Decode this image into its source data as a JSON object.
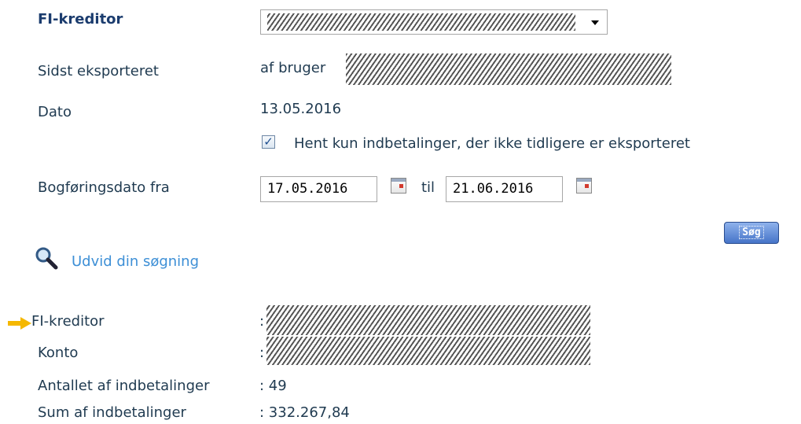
{
  "form": {
    "fi_kreditor_label": "FI-kreditor",
    "sidst_eksporteret_label": "Sidst eksporteret",
    "af_bruger_text": "af bruger",
    "dato_label": "Dato",
    "dato_value": "13.05.2016",
    "checkbox_label": "Hent kun indbetalinger, der ikke tidligere er eksporteret",
    "checkbox_checked": true,
    "bogforingsdato_label": "Bogføringsdato fra",
    "date_from": "17.05.2016",
    "til_label": "til",
    "date_to": "21.06.2016",
    "search_button": "Søg"
  },
  "expand_search_link": "Udvid din søgning",
  "results": {
    "fi_kreditor_label": "FI-kreditor",
    "konto_label": "Konto",
    "antallet_label": "Antallet af indbetalinger",
    "antallet_value": ": 49",
    "sum_label": "Sum af indbetalinger",
    "sum_value": ": 332.267,84",
    "colon": ":"
  },
  "colors": {
    "accent_link": "#3d8fd6",
    "arrow": "#f5b800",
    "button": "#4674c8"
  }
}
